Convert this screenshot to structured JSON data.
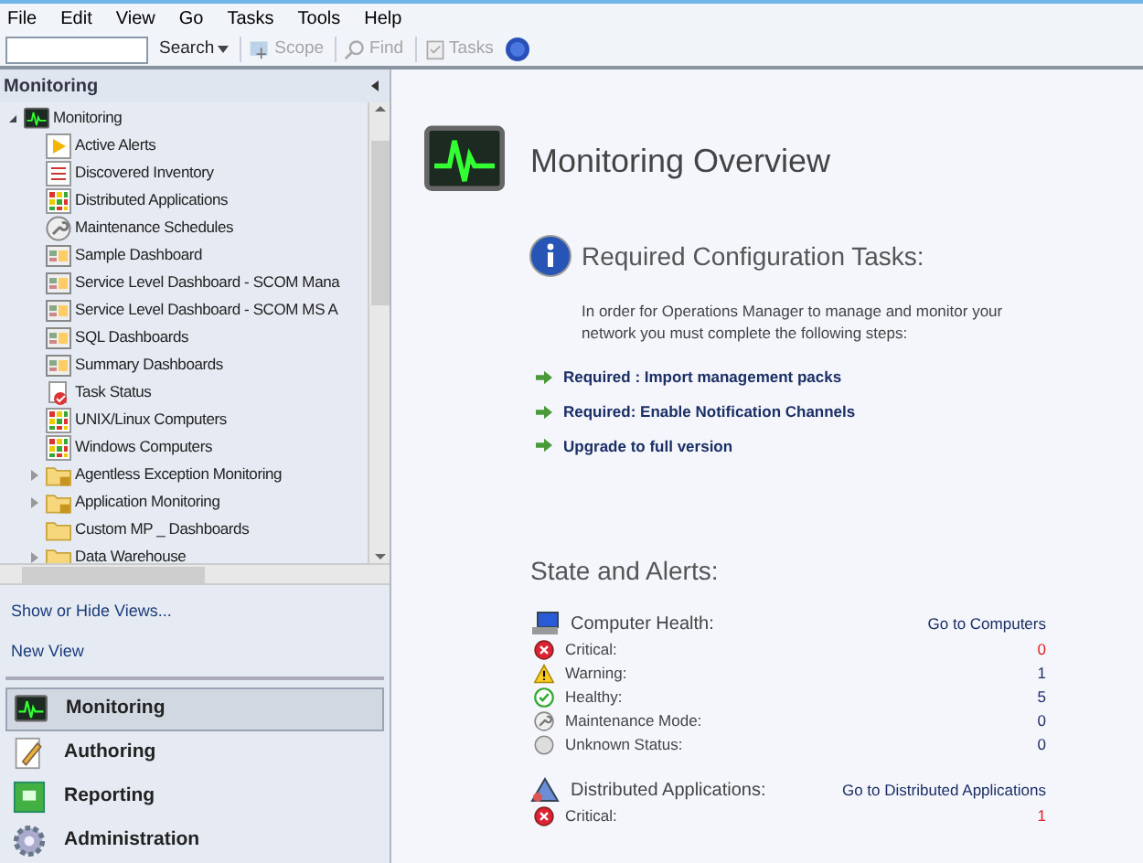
{
  "menu": [
    "File",
    "Edit",
    "View",
    "Go",
    "Tasks",
    "Tools",
    "Help"
  ],
  "toolbar": {
    "search_button": "Search",
    "buttons": [
      {
        "label": "Scope",
        "kind": "scope",
        "disabled": true
      },
      {
        "label": "Find",
        "kind": "find",
        "disabled": true
      },
      {
        "label": "Tasks",
        "kind": "tasks",
        "disabled": true
      }
    ]
  },
  "navigation": {
    "title": "Monitoring",
    "tree": [
      {
        "label": "Monitoring",
        "kind": "monitor",
        "expanded": true,
        "children": [
          {
            "label": "Active Alerts",
            "kind": "alerts"
          },
          {
            "label": "Discovered Inventory",
            "kind": "inventory"
          },
          {
            "label": "Distributed Applications",
            "kind": "grid"
          },
          {
            "label": "Maintenance Schedules",
            "kind": "wrench"
          },
          {
            "label": "Sample Dashboard",
            "kind": "dashboard"
          },
          {
            "label": "Service Level Dashboard - SCOM Mana",
            "kind": "dashboard"
          },
          {
            "label": "Service Level Dashboard - SCOM MS A",
            "kind": "dashboard"
          },
          {
            "label": "SQL Dashboards",
            "kind": "dashboard"
          },
          {
            "label": "Summary Dashboards",
            "kind": "dashboard"
          },
          {
            "label": "Task Status",
            "kind": "task"
          },
          {
            "label": "UNIX/Linux Computers",
            "kind": "grid"
          },
          {
            "label": "Windows Computers",
            "kind": "grid"
          },
          {
            "label": "Agentless Exception Monitoring",
            "kind": "locked-folder",
            "expanded": false
          },
          {
            "label": "Application Monitoring",
            "kind": "locked-folder",
            "expanded": false
          },
          {
            "label": "Custom MP _ Dashboards",
            "kind": "folder"
          },
          {
            "label": "Data Warehouse",
            "kind": "folder",
            "expanded": false
          }
        ]
      }
    ],
    "links": [
      "Show or Hide Views...",
      "New View"
    ],
    "workspaces": [
      {
        "label": "Monitoring",
        "kind": "monitor",
        "selected": true
      },
      {
        "label": "Authoring",
        "kind": "authoring",
        "selected": false
      },
      {
        "label": "Reporting",
        "kind": "reporting",
        "selected": false
      },
      {
        "label": "Administration",
        "kind": "administration",
        "selected": false
      }
    ]
  },
  "overview": {
    "title": "Monitoring Overview",
    "config": {
      "title": "Required Configuration Tasks:",
      "text": "In order for Operations Manager to manage and monitor your network you must complete the following steps:",
      "links": [
        "Required : Import management packs",
        "Required: Enable Notification Channels",
        "Upgrade to full version"
      ]
    },
    "state_title": "State and Alerts:",
    "groups": [
      {
        "title": "Computer Health:",
        "kind": "computer",
        "link": "Go to Computers",
        "rows": [
          {
            "label": "Critical:",
            "kind": "critical",
            "value": "0"
          },
          {
            "label": "Warning:",
            "kind": "warning",
            "value": "1"
          },
          {
            "label": "Healthy:",
            "kind": "healthy",
            "value": "5"
          },
          {
            "label": "Maintenance Mode:",
            "kind": "maintenance",
            "value": "0"
          },
          {
            "label": "Unknown Status:",
            "kind": "unknown",
            "value": "0"
          }
        ]
      },
      {
        "title": "Distributed Applications:",
        "kind": "application",
        "link": "Go to Distributed Applications",
        "rows": [
          {
            "label": "Critical:",
            "kind": "critical",
            "value": "1"
          }
        ]
      }
    ]
  }
}
